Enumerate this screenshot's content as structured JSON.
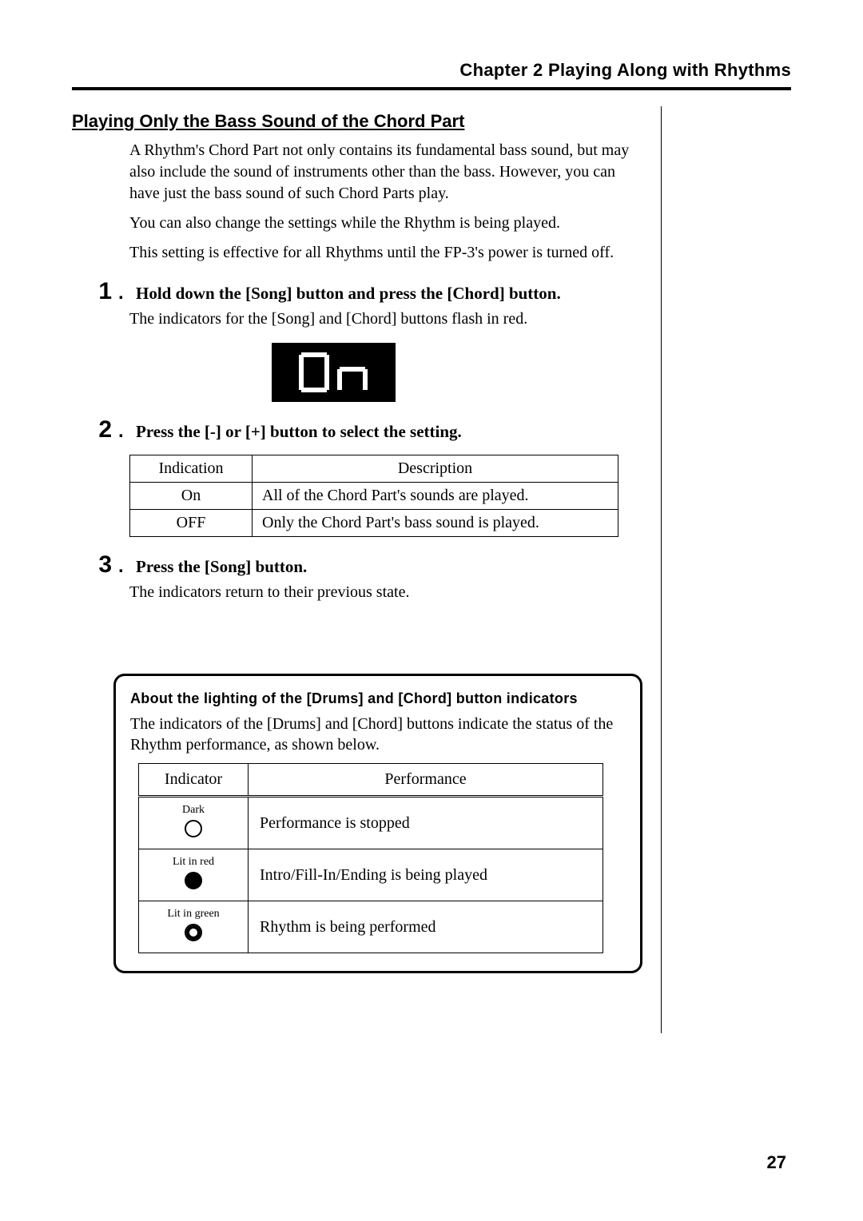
{
  "chapter_header": "Chapter 2 Playing Along with Rhythms",
  "section_title": "Playing Only the Bass Sound of the Chord Part",
  "intro": {
    "p1": "A Rhythm's Chord Part not only contains its fundamental bass sound, but may also include the sound of instruments other than the bass. However, you can have just the bass sound of such Chord Parts play.",
    "p2": "You can also change the settings while the Rhythm is being played.",
    "p3": "This setting is effective for all Rhythms until the FP-3's power is turned off."
  },
  "steps": [
    {
      "num": "1",
      "title": "Hold down the [Song] button and press the [Chord] button.",
      "body": "The indicators for the [Song] and [Chord] buttons flash in red."
    },
    {
      "num": "2",
      "title": "Press the [-] or [+] button to select the setting.",
      "body": ""
    },
    {
      "num": "3",
      "title": "Press the [Song] button.",
      "body": "The indicators return to their previous state."
    }
  ],
  "settings_table": {
    "headers": {
      "indication": "Indication",
      "description": "Description"
    },
    "rows": [
      {
        "indication": "On",
        "description": "All of the Chord Part's sounds are played."
      },
      {
        "indication": "OFF",
        "description": "Only the Chord Part's bass sound is played."
      }
    ]
  },
  "callout": {
    "title": "About the lighting of the [Drums] and [Chord] button indicators",
    "body": "The indicators of the [Drums] and [Chord] buttons indicate the status of the Rhythm performance, as shown below.",
    "table_headers": {
      "indicator": "Indicator",
      "performance": "Performance"
    },
    "rows": [
      {
        "label": "Dark",
        "performance": "Performance is stopped"
      },
      {
        "label": "Lit in red",
        "performance": "Intro/Fill-In/Ending is being played"
      },
      {
        "label": "Lit in green",
        "performance": "Rhythm is being performed"
      }
    ]
  },
  "display_text": "On",
  "page_number": "27"
}
